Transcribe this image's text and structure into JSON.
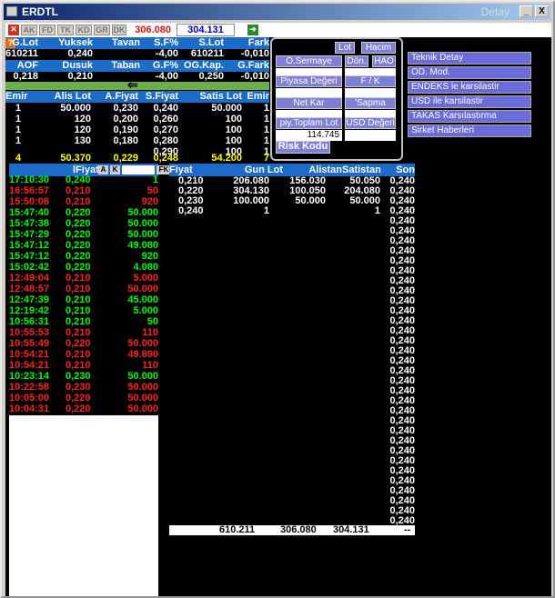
{
  "window": {
    "title": "ERDTL",
    "title_right": "Detay",
    "min": "_",
    "close": "X"
  },
  "toolbar": {
    "labels": [
      "AK",
      "FD",
      "TK",
      "KD",
      "GR",
      "DK"
    ],
    "price_red": "306.080",
    "price_blue": "304.131"
  },
  "summary": {
    "row1_headers": [
      "G.Lot",
      "Yuksek",
      "Tavan",
      "S.F%",
      "S.Lot",
      "Fark"
    ],
    "row1_values": [
      "610211",
      "0,240",
      "",
      "-4,00",
      "610211",
      "-0,010"
    ],
    "row2_headers": [
      "AOF",
      "Dusuk",
      "Taban",
      "G.F%",
      "OG.Kap.",
      "G.Fark"
    ],
    "row2_values": [
      "0,218",
      "0,210",
      "",
      "-4,00",
      "0,250",
      "-0,010"
    ],
    "arrow": "⇐"
  },
  "depth": {
    "headers": [
      "Emir",
      "Alis Lot",
      "A.Fiyat",
      "S.Fiyat",
      "Satis Lot",
      "Emir"
    ],
    "rows": [
      [
        "1",
        "50.000",
        "0,230",
        "0,240",
        "50.000",
        "1"
      ],
      [
        "1",
        "120",
        "0,200",
        "0,260",
        "100",
        "1"
      ],
      [
        "1",
        "120",
        "0,190",
        "0,270",
        "100",
        "1"
      ],
      [
        "1",
        "130",
        "0,180",
        "0,280",
        "100",
        "1"
      ],
      [
        "",
        "",
        "",
        "0,290",
        "100",
        "1"
      ]
    ],
    "totals": [
      "4",
      "50.370",
      "0,229",
      "0,248",
      "54.200",
      "7"
    ]
  },
  "panel": {
    "lot_btn": "Lot",
    "hacim_btn": "Hacim",
    "osermaye": "O.Sermaye",
    "don": "Dön.",
    "hao": "HAO",
    "piyasa": "Piyasa Değeri",
    "fk": "F / K",
    "netkar": "Net Kar",
    "sapma": "'Sapma",
    "piytoplam": "piy.Toplam Lot",
    "usd": "USD Değeri",
    "piytoplam_value": "114.745",
    "risk": "Risk Kodu"
  },
  "links": [
    "Teknik Detay",
    "OD. Mod.",
    "ENDEKS le karsilastir",
    "USD ile karsilastir",
    "TAKAS Karsılastırma",
    "Sirket Haberleri"
  ],
  "trades": {
    "headers": [
      "lFiyat",
      "A",
      "K",
      "FK"
    ],
    "rows": [
      [
        "17:10:30",
        "0,240",
        "1",
        "g"
      ],
      [
        "16:56:57",
        "0,210",
        "50",
        "r"
      ],
      [
        "15:50:08",
        "0,210",
        "920",
        "r"
      ],
      [
        "15:47:40",
        "0,220",
        "50.000",
        "g"
      ],
      [
        "15:47:38",
        "0,220",
        "50.000",
        "g"
      ],
      [
        "15:47:29",
        "0,220",
        "50.000",
        "g"
      ],
      [
        "15:47:12",
        "0,220",
        "49.080",
        "g"
      ],
      [
        "15:47:12",
        "0,220",
        "920",
        "g"
      ],
      [
        "15:02:42",
        "0,220",
        "4.080",
        "g"
      ],
      [
        "12:49:04",
        "0,210",
        "5.000",
        "r"
      ],
      [
        "12:48:57",
        "0,210",
        "50.000",
        "r"
      ],
      [
        "12:47:39",
        "0,210",
        "45.000",
        "g"
      ],
      [
        "12:19:42",
        "0,210",
        "5.000",
        "g"
      ],
      [
        "10:56:31",
        "0,210",
        "50",
        "g"
      ],
      [
        "10:55:53",
        "0,210",
        "110",
        "r"
      ],
      [
        "10:55:49",
        "0,220",
        "50.000",
        "r"
      ],
      [
        "10:54:21",
        "0,210",
        "49.890",
        "r"
      ],
      [
        "10:54:21",
        "0,210",
        "110",
        "r"
      ],
      [
        "10:23:14",
        "0,230",
        "50.000",
        "g"
      ],
      [
        "10:22:58",
        "0,230",
        "50.000",
        "r"
      ],
      [
        "10:05:00",
        "0,220",
        "50.000",
        "r"
      ],
      [
        "10:04:31",
        "0,220",
        "50.000",
        "r"
      ]
    ]
  },
  "pricevol": {
    "headers": [
      "Fiyat",
      "Gun Lot",
      "Alistan",
      "Satistan",
      "Son"
    ],
    "rows": [
      [
        "0,210",
        "206.080",
        "156.030",
        "50.050",
        "0,240"
      ],
      [
        "0,220",
        "304.130",
        "100.050",
        "204.080",
        "0,240"
      ],
      [
        "0,230",
        "100.000",
        "50.000",
        "50.000",
        "0,240"
      ],
      [
        "0,240",
        "1",
        "",
        "1",
        "0,240"
      ]
    ],
    "son_repeat": "0,240",
    "footer": [
      "610.211",
      "306.080",
      "304.131",
      "--"
    ]
  }
}
